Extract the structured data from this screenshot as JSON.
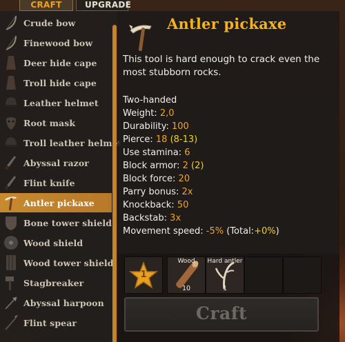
{
  "tabs": {
    "craft": "CRAFT",
    "upgrade": "UPGRADE"
  },
  "recipes": [
    {
      "label": "Crude bow",
      "icon": "bow-icon"
    },
    {
      "label": "Finewood bow",
      "icon": "bow-icon"
    },
    {
      "label": "Deer hide cape",
      "icon": "cape-icon"
    },
    {
      "label": "Troll hide cape",
      "icon": "cape-icon"
    },
    {
      "label": "Leather helmet",
      "icon": "helmet-icon"
    },
    {
      "label": "Root mask",
      "icon": "mask-icon"
    },
    {
      "label": "Troll leather helmet",
      "icon": "helmet-icon"
    },
    {
      "label": "Abyssal razor",
      "icon": "knife-icon"
    },
    {
      "label": "Flint knife",
      "icon": "knife-icon"
    },
    {
      "label": "Antler pickaxe",
      "icon": "pickaxe-icon",
      "selected": true
    },
    {
      "label": "Bone tower shield",
      "icon": "shield-icon"
    },
    {
      "label": "Wood shield",
      "icon": "round-shield-icon"
    },
    {
      "label": "Wood tower shield",
      "icon": "tower-shield-icon"
    },
    {
      "label": "Stagbreaker",
      "icon": "hammer-icon"
    },
    {
      "label": "Abyssal harpoon",
      "icon": "harpoon-icon"
    },
    {
      "label": "Flint spear",
      "icon": "spear-icon"
    }
  ],
  "item": {
    "title": "Antler pickaxe",
    "description": "This tool is hard enough to crack even the most stubborn rocks.",
    "handedness": "Two-handed",
    "weight_label": "Weight: ",
    "weight": "2,0",
    "durability_label": "Durability: ",
    "durability": "100",
    "pierce_label": "Pierce: ",
    "pierce": "18",
    "pierce_range": "(8-13)",
    "stamina_label": "Use stamina: ",
    "stamina": "6",
    "block_armor_label": "Block armor: ",
    "block_armor": "2",
    "block_armor_extra": "(2)",
    "block_force_label": "Block force: ",
    "block_force": "20",
    "parry_label": "Parry bonus: ",
    "parry": "2x",
    "knockback_label": "Knockback: ",
    "knockback": "50",
    "backstab_label": "Backstab: ",
    "backstab": "3x",
    "movement_label": "Movement speed: ",
    "movement": "-5%",
    "total_open": "(Total:",
    "total": "+0%",
    "total_close": ")"
  },
  "requirements": {
    "level": "1",
    "slots": [
      {
        "name": "Wood",
        "amount": "10",
        "icon": "wood-log-icon"
      },
      {
        "name": "Hard antler",
        "amount": "1",
        "icon": "antler-icon"
      }
    ]
  },
  "craft_button": "Craft",
  "colors": {
    "accent": "#f4b21c",
    "selected_row": "#c88a2e",
    "stat_value": "#f0a428"
  }
}
